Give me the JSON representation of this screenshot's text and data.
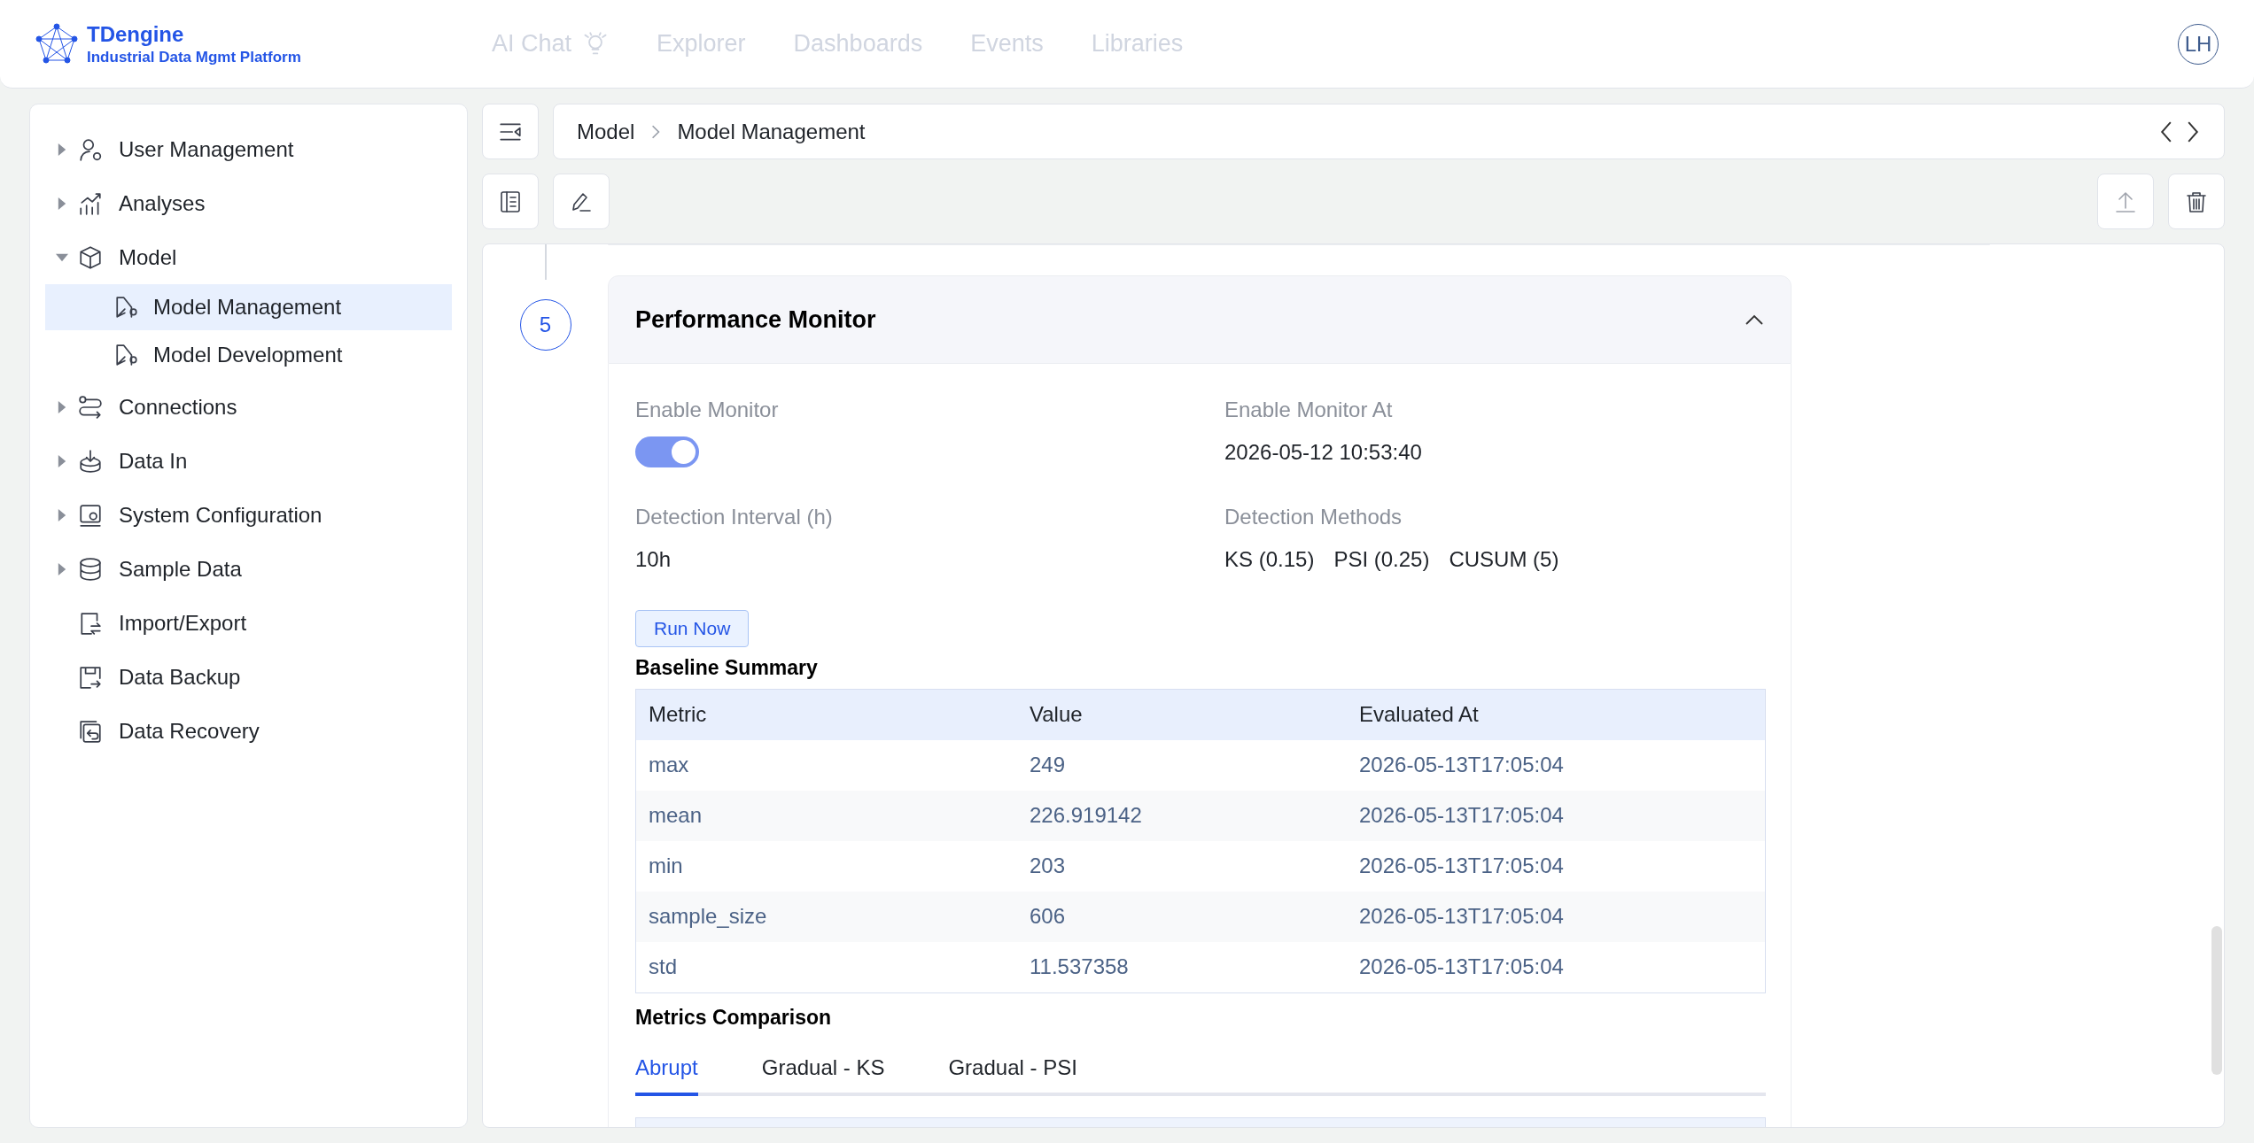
{
  "header": {
    "logo": {
      "name": "TDengine",
      "tagline": "Industrial Data Mgmt Platform"
    },
    "nav": [
      {
        "label": "AI Chat"
      },
      {
        "label": "Explorer"
      },
      {
        "label": "Dashboards"
      },
      {
        "label": "Events"
      },
      {
        "label": "Libraries"
      }
    ],
    "avatar": "LH"
  },
  "sidebar": {
    "items": [
      {
        "label": "User Management",
        "kind": "group",
        "expanded": false,
        "selected": false
      },
      {
        "label": "Analyses",
        "kind": "group",
        "expanded": false,
        "selected": false
      },
      {
        "label": "Model",
        "kind": "group",
        "expanded": true,
        "selected": false,
        "children": [
          {
            "label": "Model Management",
            "selected": true
          },
          {
            "label": "Model Development",
            "selected": false
          }
        ]
      },
      {
        "label": "Connections",
        "kind": "group",
        "expanded": false,
        "selected": false
      },
      {
        "label": "Data In",
        "kind": "group",
        "expanded": false,
        "selected": false
      },
      {
        "label": "System Configuration",
        "kind": "group",
        "expanded": false,
        "selected": false
      },
      {
        "label": "Sample Data",
        "kind": "group",
        "expanded": false,
        "selected": false
      },
      {
        "label": "Import/Export",
        "kind": "link",
        "selected": false
      },
      {
        "label": "Data Backup",
        "kind": "link",
        "selected": false
      },
      {
        "label": "Data Recovery",
        "kind": "link",
        "selected": false
      }
    ]
  },
  "breadcrumb": [
    "Model",
    "Model Management"
  ],
  "step": {
    "number": "5",
    "title": "Performance Monitor",
    "expanded": true,
    "fields": [
      {
        "label": "Enable Monitor",
        "kind": "toggle",
        "on": true
      },
      {
        "label": "Enable Monitor At",
        "kind": "text",
        "value": "2026-05-12 10:53:40"
      },
      {
        "label": "Detection Interval (h)",
        "kind": "text",
        "value": "10h"
      },
      {
        "label": "Detection Methods",
        "kind": "list",
        "values": [
          "KS (0.15)",
          "PSI (0.25)",
          "CUSUM (5)"
        ]
      }
    ],
    "run_button": "Run Now",
    "baseline": {
      "title": "Baseline Summary",
      "columns": [
        "Metric",
        "Value",
        "Evaluated At"
      ],
      "rows": [
        [
          "max",
          "249",
          "2026-05-13T17:05:04"
        ],
        [
          "mean",
          "226.919142",
          "2026-05-13T17:05:04"
        ],
        [
          "min",
          "203",
          "2026-05-13T17:05:04"
        ],
        [
          "sample_size",
          "606",
          "2026-05-13T17:05:04"
        ],
        [
          "std",
          "11.537358",
          "2026-05-13T17:05:04"
        ]
      ]
    },
    "metrics": {
      "title": "Metrics Comparison",
      "tabs": [
        {
          "label": "Abrupt",
          "selected": true
        },
        {
          "label": "Gradual - KS",
          "selected": false
        },
        {
          "label": "Gradual - PSI",
          "selected": false
        }
      ]
    }
  }
}
